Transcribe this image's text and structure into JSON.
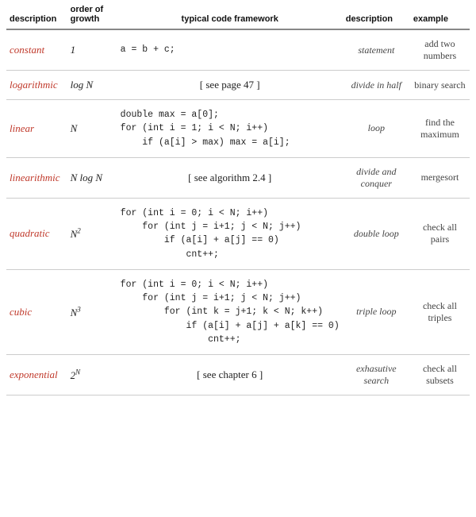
{
  "header": {
    "col1": "description",
    "col2": "order of growth",
    "col3": "typical code framework",
    "col4": "description",
    "col5": "example"
  },
  "rows": [
    {
      "desc": "constant",
      "order": "1",
      "order_type": "plain",
      "code_type": "code",
      "code": "a = b + c;",
      "desc2": "statement",
      "example": "add two numbers"
    },
    {
      "desc": "logarithmic",
      "order": "log N",
      "order_type": "italic",
      "code_type": "ref",
      "code": "[ see page 47 ]",
      "desc2": "divide in half",
      "example": "binary search"
    },
    {
      "desc": "linear",
      "order": "N",
      "order_type": "italic",
      "code_type": "code",
      "code": "double max = a[0];\nfor (int i = 1; i < N; i++)\n    if (a[i] > max) max = a[i];",
      "desc2": "loop",
      "example": "find the maximum"
    },
    {
      "desc": "linearithmic",
      "order": "N log N",
      "order_type": "italic",
      "code_type": "ref",
      "code": "[ see ALGORITHM 2.4 ]",
      "desc2": "divide and conquer",
      "example": "mergesort"
    },
    {
      "desc": "quadratic",
      "order": "N²",
      "order_type": "italic",
      "code_type": "code",
      "code": "for (int i = 0; i < N; i++)\n    for (int j = i+1; j < N; j++)\n        if (a[i] + a[j] == 0)\n            cnt++;",
      "desc2": "double loop",
      "example": "check all pairs"
    },
    {
      "desc": "cubic",
      "order": "N³",
      "order_type": "italic",
      "code_type": "code",
      "code": "for (int i = 0; i < N; i++)\n    for (int j = i+1; j < N; j++)\n        for (int k = j+1; k < N; k++)\n            if (a[i] + a[j] + a[k] == 0)\n                cnt++;",
      "desc2": "triple loop",
      "example": "check all triples"
    },
    {
      "desc": "exponential",
      "order": "2^N",
      "order_type": "italic",
      "code_type": "ref",
      "code": "[ see CHAPTER 6 ]",
      "desc2": "exhasutive search",
      "example": "check all subsets"
    }
  ]
}
